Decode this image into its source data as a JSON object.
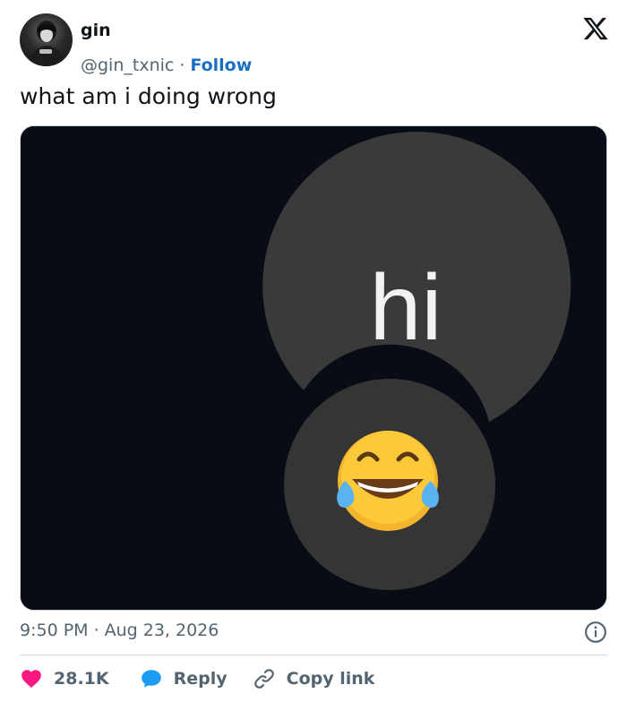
{
  "author": {
    "name": "gin",
    "handle": "@gin_txnic",
    "separator": "·",
    "follow_label": "Follow"
  },
  "tweet": {
    "text": "what am i doing wrong",
    "media": {
      "bubble_text": "hi",
      "emoji": "😂"
    }
  },
  "meta": {
    "time": "9:50 PM",
    "separator": "·",
    "date": "Aug 23, 2026"
  },
  "actions": {
    "likes": "28.1K",
    "reply_label": "Reply",
    "copy_label": "Copy link"
  },
  "icons": {
    "like": "heart-icon",
    "reply": "speech-bubble-icon",
    "copy": "link-icon",
    "info": "info-icon",
    "brand": "x-logo-icon"
  },
  "colors": {
    "heart": "#f91880",
    "reply": "#1d9bf0",
    "follow": "#1d6fc4",
    "muted": "#536471",
    "media_bg": "#080c15",
    "bubble": "#3a3a3a"
  }
}
